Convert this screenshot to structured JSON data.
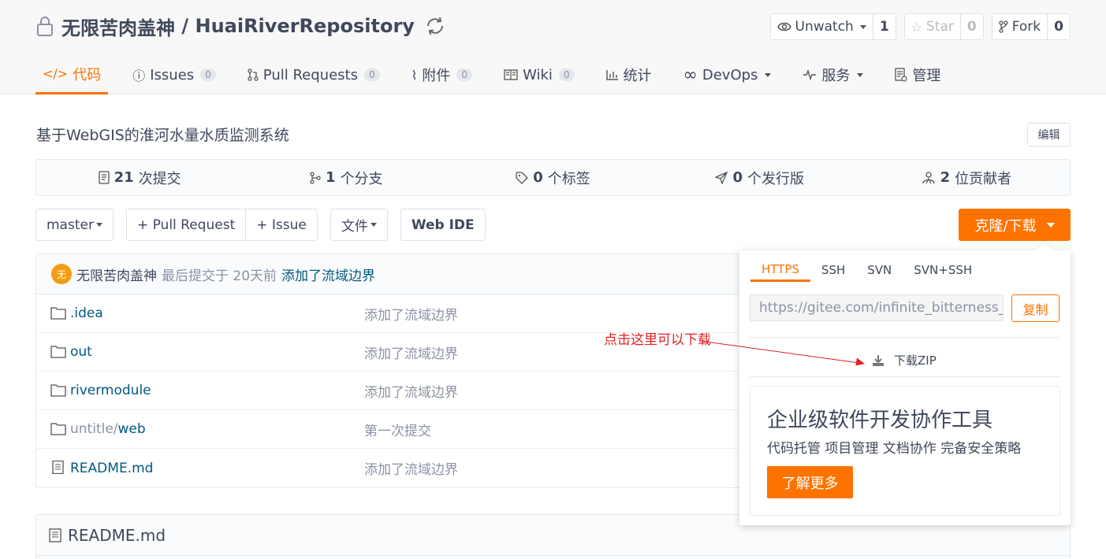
{
  "repo": {
    "owner": "无限苦肉盖神",
    "separator": " / ",
    "name": "HuaiRiverRepository"
  },
  "actions": [
    {
      "label": "Unwatch",
      "count": "1",
      "icon": "eye-icon"
    },
    {
      "label": "Star",
      "count": "0",
      "icon": "star-icon"
    },
    {
      "label": "Fork",
      "count": "0",
      "icon": "fork-icon"
    }
  ],
  "tabs": [
    {
      "label": "代码",
      "icon": "code-icon",
      "active": true
    },
    {
      "label": "Issues",
      "badge": "0",
      "icon": "issue-icon"
    },
    {
      "label": "Pull Requests",
      "badge": "0",
      "icon": "pull-request-icon"
    },
    {
      "label": "附件",
      "badge": "0",
      "icon": "attachment-icon"
    },
    {
      "label": "Wiki",
      "badge": "0",
      "icon": "wiki-icon"
    },
    {
      "label": "统计",
      "icon": "chart-icon"
    },
    {
      "label": "DevOps",
      "icon": "infinity-icon"
    },
    {
      "label": "服务",
      "icon": "pulse-icon"
    },
    {
      "label": "管理",
      "icon": "manage-icon"
    }
  ],
  "description": "基于WebGIS的淮河水量水质监测系统",
  "edit_label": "编辑",
  "stats": [
    {
      "count": "21",
      "label": "次提交",
      "icon": "commit-icon"
    },
    {
      "count": "1",
      "label": "个分支",
      "icon": "branch-icon"
    },
    {
      "count": "0",
      "label": "个标签",
      "icon": "tag-icon"
    },
    {
      "count": "0",
      "label": "个发行版",
      "icon": "release-icon"
    },
    {
      "count": "2",
      "label": "位贡献者",
      "icon": "contributors-icon"
    }
  ],
  "toolbar": {
    "branch": "master",
    "pull_request": "+ Pull Request",
    "issue": "+ Issue",
    "files": "文件",
    "web_ide": "Web IDE",
    "clone": "克隆/下载"
  },
  "last_commit": {
    "avatar_letter": "无",
    "author": "无限苦肉盖神",
    "meta": "最后提交于 20天前",
    "message": "添加了流域边界"
  },
  "files": [
    {
      "name": ".idea",
      "type": "folder",
      "message": "添加了流域边界"
    },
    {
      "name": "out",
      "type": "folder",
      "message": "添加了流域边界"
    },
    {
      "name": "rivermodule",
      "type": "folder",
      "message": "添加了流域边界"
    },
    {
      "name_prefix": "untitle/",
      "name": "web",
      "type": "folder",
      "message": "第一次提交"
    },
    {
      "name": "README.md",
      "type": "file",
      "message": "添加了流域边界"
    }
  ],
  "readme_title": "README.md",
  "clone_popup": {
    "tabs": [
      "HTTPS",
      "SSH",
      "SVN",
      "SVN+SSH"
    ],
    "active_tab": "HTTPS",
    "url": "https://gitee.com/infinite_bitterness_co",
    "copy_label": "复制",
    "download_zip": "下载ZIP",
    "promo_title": "企业级软件开发协作工具",
    "promo_subtitle": "代码托管 项目管理 文档协作 完备安全策略",
    "promo_button": "了解更多"
  },
  "annotation": "点击这里可以下载",
  "colors": {
    "accent": "#fe7300",
    "link": "#005980",
    "muted": "#8c92a4",
    "annotation": "#e02020"
  }
}
